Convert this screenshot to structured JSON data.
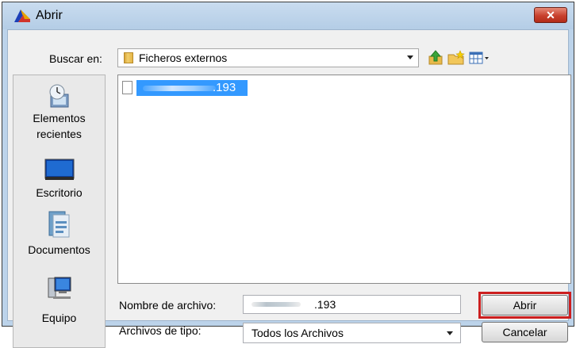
{
  "window": {
    "title": "Abrir",
    "close_glyph": "✕"
  },
  "toolbar": {
    "look_in_label": "Buscar en:",
    "look_in_value": "Ficheros externos",
    "icons": [
      "up-folder-icon",
      "new-folder-icon",
      "view-menu-icon"
    ]
  },
  "places": [
    {
      "label": "Elementos recientes",
      "icon": "recent-items-icon"
    },
    {
      "label": "Escritorio",
      "icon": "desktop-icon"
    },
    {
      "label": "Documentos",
      "icon": "documents-icon"
    },
    {
      "label": "Equipo",
      "icon": "computer-icon"
    }
  ],
  "file_list": {
    "items": [
      {
        "name": ".193",
        "selected": true
      }
    ]
  },
  "filename": {
    "label": "Nombre de archivo:",
    "value": ".193"
  },
  "filetype": {
    "label": "Archivos de tipo:",
    "value": "Todos los Archivos"
  },
  "buttons": {
    "open": "Abrir",
    "cancel": "Cancelar"
  },
  "colors": {
    "title_bar": "#bcd3ea",
    "selection": "#3399ff",
    "highlight_box": "#cc1f1f"
  }
}
